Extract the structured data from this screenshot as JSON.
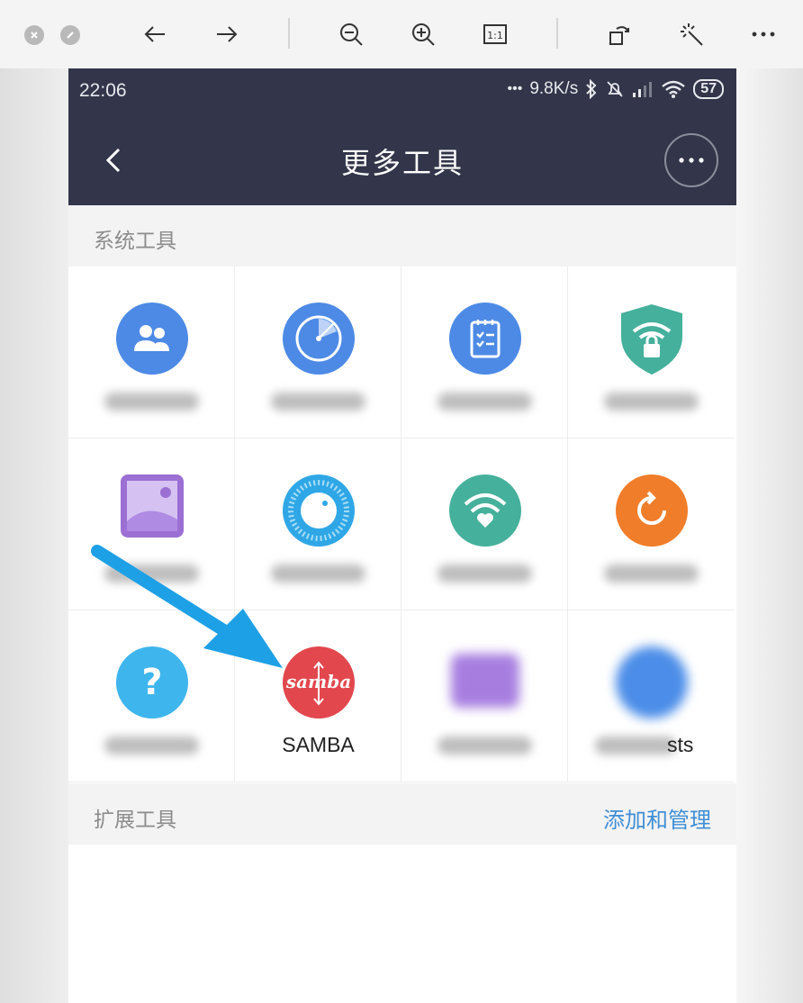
{
  "viewer": {
    "icons": [
      "close-window-icon",
      "minimize-window-icon",
      "back-arrow-icon",
      "forward-arrow-icon",
      "zoom-out-icon",
      "zoom-in-icon",
      "actual-size-icon",
      "rotate-icon",
      "magic-wand-icon",
      "more-dots-icon"
    ],
    "actual_size_label": "1:1"
  },
  "status_bar": {
    "time": "22:06",
    "dots": "•••",
    "speed": "9.8K/s",
    "battery": "57"
  },
  "header": {
    "title": "更多工具"
  },
  "system_section": {
    "label": "系统工具",
    "tools": [
      {
        "name": "tool-users",
        "label": "",
        "color": "#4d8ae6",
        "icon": "users-icon"
      },
      {
        "name": "tool-radar",
        "label": "",
        "color": "#4d8ae6",
        "icon": "radar-icon"
      },
      {
        "name": "tool-clipboard",
        "label": "",
        "color": "#4d8ae6",
        "icon": "clipboard-icon"
      },
      {
        "name": "tool-wifi-shield",
        "label": "",
        "color": "#45b09b",
        "icon": "wifi-shield-icon"
      },
      {
        "name": "tool-gallery",
        "label": "",
        "color": "#9b6fd3",
        "icon": "image-icon"
      },
      {
        "name": "tool-dial",
        "label": "",
        "color": "#2fa7e6",
        "icon": "dial-icon"
      },
      {
        "name": "tool-wifi-heart",
        "label": "",
        "color": "#45b09b",
        "icon": "wifi-heart-icon"
      },
      {
        "name": "tool-timer",
        "label": "",
        "color": "#f07d2a",
        "icon": "timer-icon"
      },
      {
        "name": "tool-help",
        "label": "",
        "color": "#3fb5ee",
        "icon": "question-icon"
      },
      {
        "name": "tool-samba",
        "label": "SAMBA",
        "color": "#e2474d",
        "icon": "samba-icon"
      },
      {
        "name": "tool-purple",
        "label": "",
        "color": "#a77ee0",
        "icon": "blurred-icon"
      },
      {
        "name": "tool-hosts",
        "label": "sts",
        "color": "#4b8de8",
        "icon": "blurred-icon"
      }
    ]
  },
  "extension_section": {
    "label": "扩展工具",
    "manage_label": "添加和管理"
  },
  "samba_glyph": "samba",
  "question_glyph": "?",
  "colors": {
    "header_bg": "#33364a",
    "accent": "#3f8fd6",
    "arrow": "#1ea0e6"
  }
}
